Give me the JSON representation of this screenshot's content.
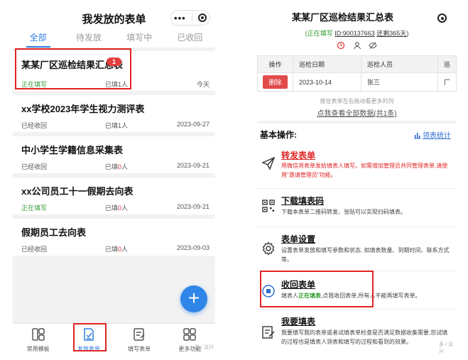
{
  "left": {
    "title": "我发放的表单",
    "tabs": [
      "全部",
      "待发放",
      "填写中",
      "已收回"
    ],
    "cards": [
      {
        "title": "某某厂区巡检结果汇总表",
        "badge": "1",
        "status": "正在填写",
        "status_color": "green",
        "fill_prefix": "已填",
        "fill_count": "1",
        "fill_suffix": "人",
        "date": "今天"
      },
      {
        "title": "xx学校2023年学生视力测评表",
        "status": "已经收回",
        "status_color": "gray",
        "fill_prefix": "已填",
        "fill_count": "1",
        "fill_suffix": "人",
        "date": "2023-09-27"
      },
      {
        "title": "中小学生学籍信息采集表",
        "status": "已经收回",
        "status_color": "gray",
        "fill_prefix": "已填",
        "fill_count": "0",
        "fill_suffix": "人",
        "date": "2023-09-21"
      },
      {
        "title": "xx公司员工十一假期去向表",
        "status": "正在填写",
        "status_color": "green",
        "fill_prefix": "已填",
        "fill_count": "0",
        "fill_suffix": "人",
        "date": "2023-09-21"
      },
      {
        "title": "假期员工去向表",
        "status": "已经收回",
        "status_color": "gray",
        "fill_prefix": "已填",
        "fill_count": "0",
        "fill_suffix": "人",
        "date": "2023-09-03"
      }
    ],
    "nav": [
      {
        "label": "常用模板",
        "icon": "template-icon"
      },
      {
        "label": "发放表单",
        "icon": "send-form-icon"
      },
      {
        "label": "填写表单",
        "icon": "fill-form-icon"
      },
      {
        "label": "更多功能",
        "icon": "grid-icon"
      }
    ],
    "watermark": "多 / 法兴"
  },
  "right": {
    "title": "某某厂区巡检结果汇总表",
    "meta": {
      "status": "(正在填写",
      "id": "ID:900137663",
      "expire": "还剩365天",
      "close": ")"
    },
    "table": {
      "headers": [
        "操作",
        "巡检日期",
        "巡检人员",
        "巡"
      ],
      "row": {
        "action": "删除",
        "date": "2023-10-14",
        "person": "张三",
        "extra": "厂"
      }
    },
    "hint": "按住表单左右拖动看更多的列",
    "view_all": "点我查看全部数据(共1条)",
    "section_title": "基本操作:",
    "stat_link": "领表统计",
    "ops": [
      {
        "title": "转发表单",
        "desc": "用微信将表单发给填表人填写。如需增加管理员共同管理表单,请使用\"邀请管理员\"功能。",
        "icon": "send-icon"
      },
      {
        "title": "下载填表码",
        "desc": "下载本表单二维码转发、张贴可以实现扫码填表。",
        "icon": "qrcode-icon"
      },
      {
        "title": "表单设置",
        "desc": "设置表单发放和填写参数和状态, 如填表数量、到期时间、联系方式等。",
        "icon": "settings-icon"
      },
      {
        "title": "收回表单",
        "desc_pre": "填表人",
        "desc_green": "正在填表",
        "desc_post": ",点我收回表单,所有人不能再填写表单。",
        "icon": "recall-icon"
      },
      {
        "title": "我要填表",
        "desc": "我要填写我的表单或者试填表单检查是否满足数据收集需要,您试填的过程也是填表人领表和填写的过程和看到的效果。",
        "icon": "write-icon"
      }
    ],
    "watermark": "多 / 法兴"
  },
  "colors": {
    "accent_blue": "#2f7de1",
    "highlight_red": "#e02424",
    "status_green": "#3a9a3a",
    "badge_red": "#e33d3d"
  }
}
